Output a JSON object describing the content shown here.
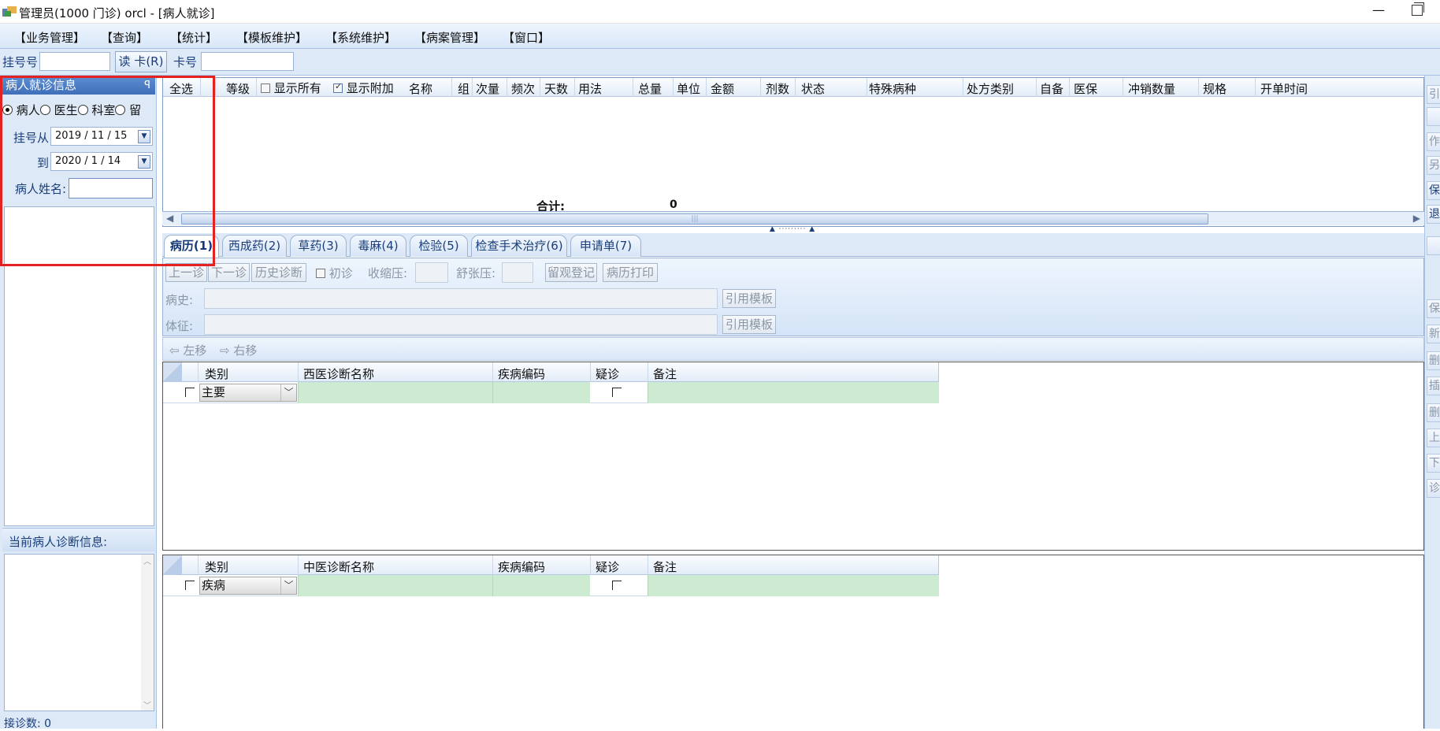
{
  "window": {
    "title": "管理员(1000 门诊)  orcl - [病人就诊]",
    "minimize": "—"
  },
  "menu": [
    "【业务管理】",
    "【查询】",
    "【统计】",
    "【模板维护】",
    "【系统维护】",
    "【病案管理】",
    "【窗口】"
  ],
  "toolbar": {
    "reg_no_label": "挂号号",
    "read_card_label": "读 卡(R)",
    "card_no_label": "卡号"
  },
  "left_panel": {
    "header": "病人就诊信息",
    "pin": "ꟼ",
    "radios": [
      {
        "label": "病人",
        "selected": true
      },
      {
        "label": "医生",
        "selected": false
      },
      {
        "label": "科室",
        "selected": false
      },
      {
        "label": "留",
        "selected": false
      }
    ],
    "date_from_label": "挂号从",
    "date_from": "2019 / 11 / 15",
    "date_to_label": "到",
    "date_to": "2020 / 1 / 14",
    "patient_name_label": "病人姓名:",
    "diag_info_header": "当前病人诊断信息:",
    "visit_count": "接诊数: 0"
  },
  "rx_grid": {
    "columns": [
      "全选",
      "等级",
      "显示所有",
      "显示附加",
      "名称",
      "组",
      "次量",
      "频次",
      "天数",
      "用法",
      "总量",
      "单位",
      "金额",
      "剂数",
      "状态",
      "特殊病种",
      "处方类别",
      "自备",
      "医保",
      "冲销数量",
      "规格",
      "开单时间"
    ],
    "total_label": "合计:",
    "total_value": "0"
  },
  "tabs": [
    {
      "label": "病历(1)",
      "active": true
    },
    {
      "label": "西成药(2)",
      "active": false
    },
    {
      "label": "草药(3)",
      "active": false
    },
    {
      "label": "毒麻(4)",
      "active": false
    },
    {
      "label": "检验(5)",
      "active": false
    },
    {
      "label": "检查手术治疗(6)",
      "active": false
    },
    {
      "label": "申请单(7)",
      "active": false
    }
  ],
  "medical_record": {
    "prev_visit": "上一诊",
    "next_visit": "下一诊",
    "history_diag": "历史诊断",
    "first_visit": "初诊",
    "systolic_label": "收缩压:",
    "diastolic_label": "舒张压:",
    "observation_reg": "留观登记",
    "print_record": "病历打印",
    "history_label": "病史:",
    "sign_label": "体征:",
    "use_template": "引用模板",
    "move_left": "左移",
    "move_right": "右移"
  },
  "western_dx": {
    "columns": [
      "类别",
      "西医诊断名称",
      "疾病编码",
      "疑诊",
      "备注"
    ],
    "row_category": "主要"
  },
  "chinese_dx": {
    "columns": [
      "类别",
      "中医诊断名称",
      "疾病编码",
      "疑诊",
      "备注"
    ],
    "row_category": "疾病"
  },
  "right_sidebar": [
    "引",
    "",
    "作",
    "另",
    "保",
    "退",
    "",
    "",
    "保",
    "新",
    "删",
    "插",
    "删",
    "上",
    "下",
    "诊"
  ],
  "colors": {
    "accent": "#3f6fb8",
    "panel_bg": "#dde9f7",
    "grid_green": "#cdebd0",
    "highlight": "#e52222"
  }
}
